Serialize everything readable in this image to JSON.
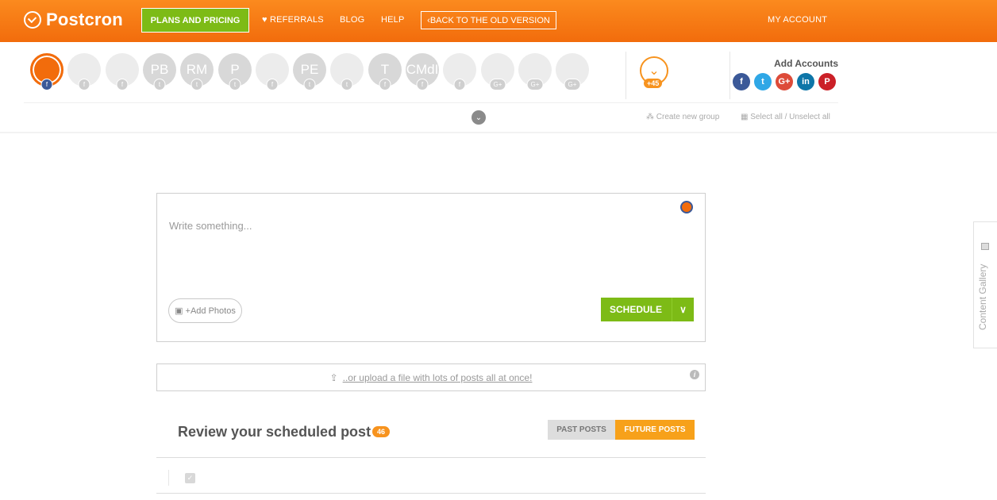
{
  "app": {
    "name": "Postcron"
  },
  "topnav": {
    "plans": "PLANS AND PRICING",
    "referrals": "REFERRALS",
    "blog": "BLOG",
    "help": "HELP",
    "back": "BACK TO THE OLD VERSION",
    "my_account": "MY ACCOUNT"
  },
  "accounts": [
    {
      "initials": "",
      "badge": "f",
      "active": true
    },
    {
      "initials": "",
      "badge": "f",
      "active": false
    },
    {
      "initials": "",
      "badge": "f",
      "active": false
    },
    {
      "initials": "PB",
      "badge": "t",
      "active": false
    },
    {
      "initials": "RM",
      "badge": "t",
      "active": false
    },
    {
      "initials": "P",
      "badge": "t",
      "active": false
    },
    {
      "initials": "",
      "badge": "f",
      "active": false
    },
    {
      "initials": "PE",
      "badge": "t",
      "active": false
    },
    {
      "initials": "",
      "badge": "t",
      "active": false
    },
    {
      "initials": "T",
      "badge": "f",
      "active": false
    },
    {
      "initials": "CMdI",
      "badge": "f",
      "active": false
    },
    {
      "initials": "",
      "badge": "f",
      "active": false
    },
    {
      "initials": "",
      "badge": "G+",
      "active": false
    },
    {
      "initials": "",
      "badge": "G+",
      "active": false
    },
    {
      "initials": "",
      "badge": "G+",
      "active": false
    }
  ],
  "more_accounts": "+45",
  "add_accounts": {
    "title": "Add Accounts",
    "networks": [
      "f",
      "t",
      "G+",
      "in",
      "P"
    ]
  },
  "groups": {
    "create": "Create new group",
    "select": "Select all / Unselect all"
  },
  "composer": {
    "placeholder": "Write something...",
    "add_photos": "+Add Photos",
    "schedule": "SCHEDULE"
  },
  "upload": {
    "text": "..or upload a file with lots of posts all at once!"
  },
  "review": {
    "title": "Review your scheduled post",
    "count": "46",
    "past": "PAST POSTS",
    "future": "FUTURE POSTS"
  },
  "gallery": {
    "label": "Content Gallery"
  },
  "colors": {
    "brand_orange": "#f77a15",
    "accent_green": "#7dbb16",
    "facebook": "#3b5998",
    "future_tab": "#f7a11a"
  }
}
